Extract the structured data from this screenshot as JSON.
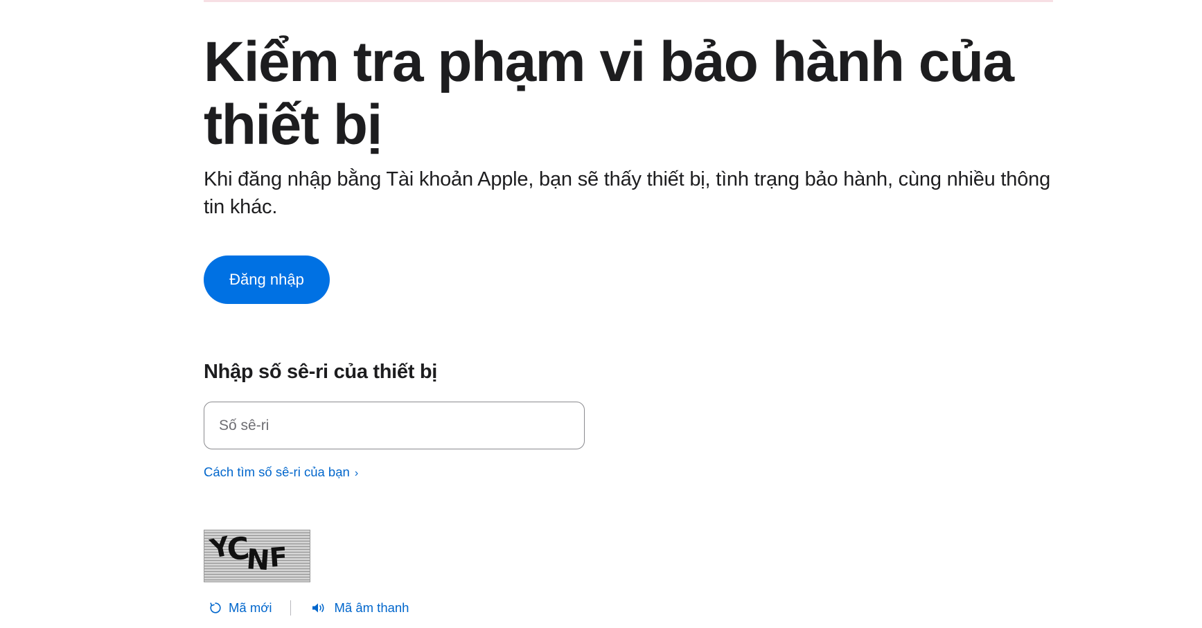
{
  "page": {
    "title": "Kiểm tra phạm vi bảo hành của thiết bị",
    "subtitle": "Khi đăng nhập bằng Tài khoản Apple, bạn sẽ thấy thiết bị, tình trạng bảo hành, cùng nhiều thông tin khác."
  },
  "signin": {
    "label": "Đăng nhập"
  },
  "serial": {
    "heading": "Nhập số sê-ri của thiết bị",
    "placeholder": "Số sê-ri",
    "value": "",
    "find_link": "Cách tìm số sê-ri của bạn",
    "find_link_chevron": "›"
  },
  "captcha": {
    "code": "YCNF",
    "refresh_label": "Mã mới",
    "audio_label": "Mã âm thanh",
    "icons": [
      "refresh-icon",
      "speaker-icon"
    ]
  },
  "colors": {
    "accent": "#0071e3",
    "link": "#0066cc",
    "text": "#1d1d1f"
  }
}
